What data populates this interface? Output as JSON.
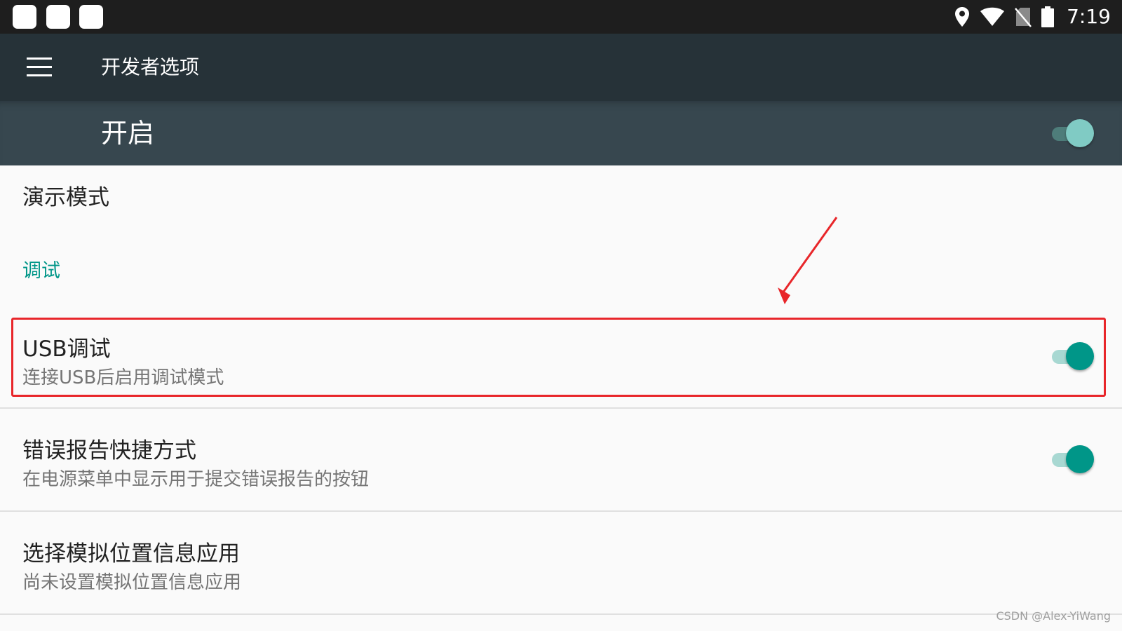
{
  "status_bar": {
    "time": "7:19",
    "icons": [
      "location-icon",
      "wifi-icon",
      "no-sim-icon",
      "battery-icon"
    ]
  },
  "toolbar": {
    "title": "开发者选项",
    "menu_icon": "hamburger-menu-icon"
  },
  "master_switch": {
    "label": "开启",
    "checked": true
  },
  "items": {
    "demo_mode": {
      "title": "演示模式"
    },
    "debug_category": {
      "label": "调试"
    },
    "usb_debugging": {
      "title": "USB调试",
      "summary": "连接USB后启用调试模式",
      "checked": true
    },
    "bugreport_shortcut": {
      "title": "错误报告快捷方式",
      "summary": "在电源菜单中显示用于提交错误报告的按钮",
      "checked": true
    },
    "mock_location": {
      "title": "选择模拟位置信息应用",
      "summary": "尚未设置模拟位置信息应用"
    }
  },
  "annotation": {
    "color": "#e8262a"
  },
  "watermark": "CSDN @Alex-YiWang",
  "colors": {
    "status_bar": "#1e1e1e",
    "toolbar": "#263238",
    "master_bar": "#37474f",
    "accent": "#009688",
    "background": "#fafafa"
  }
}
